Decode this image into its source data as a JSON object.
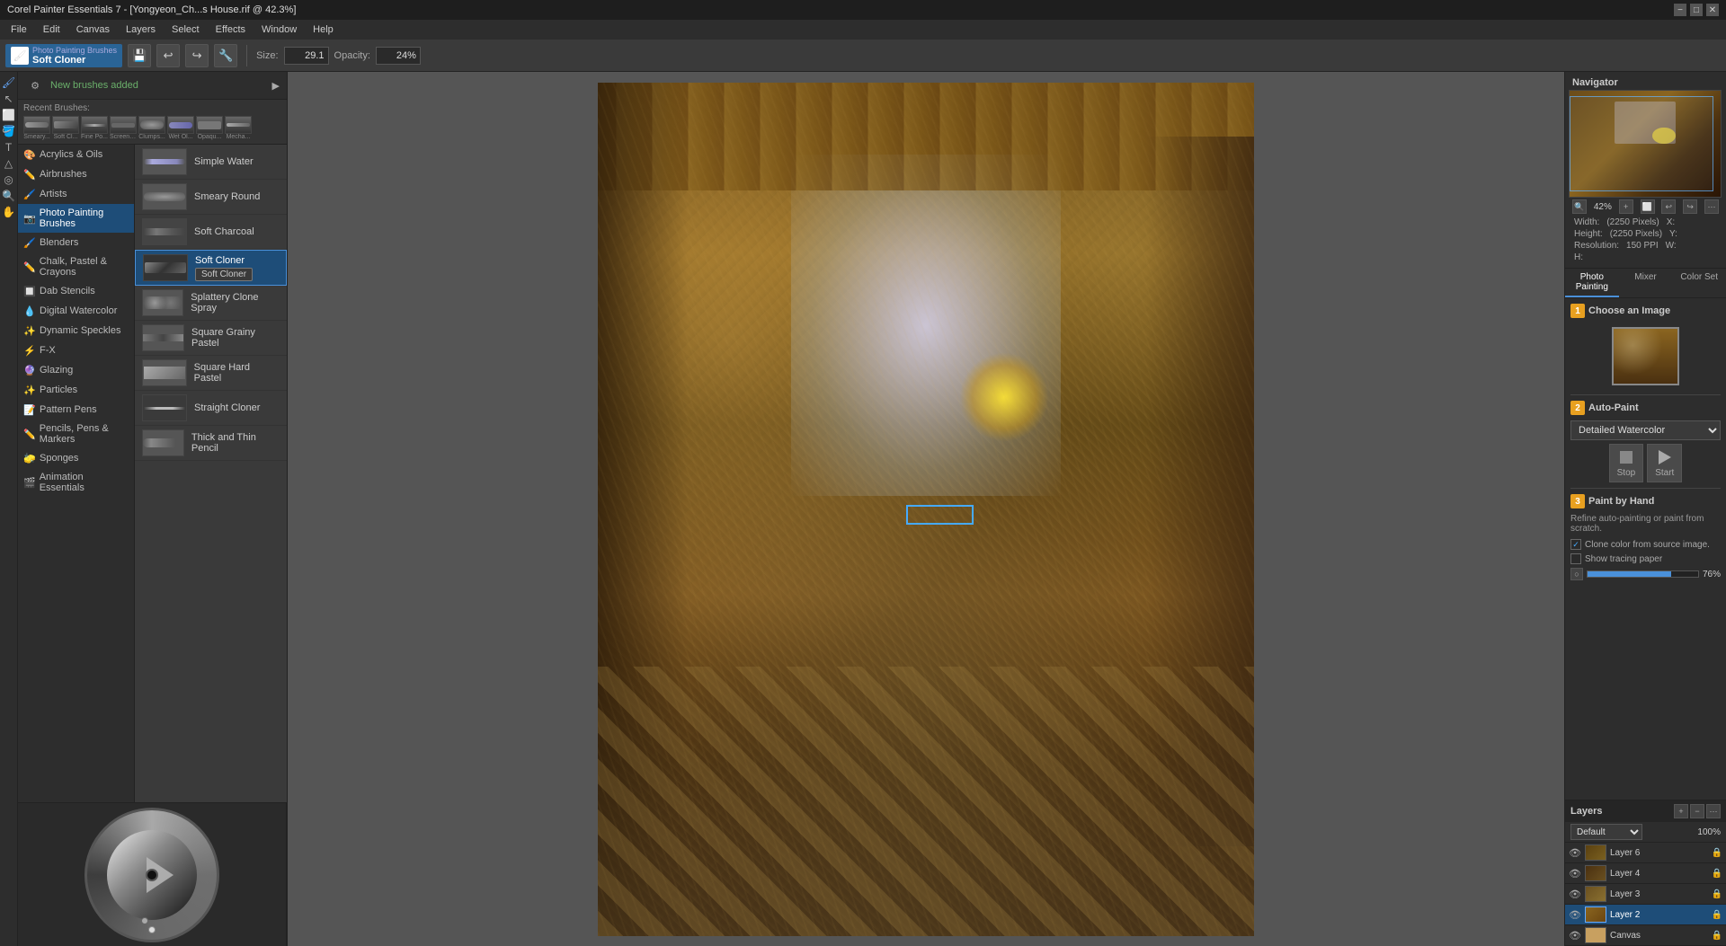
{
  "titleBar": {
    "title": "Corel Painter Essentials 7 - [Yongyeon_Ch...s House.rif @ 42.3%]",
    "winControls": [
      "−",
      "□",
      "✕"
    ]
  },
  "menuBar": {
    "items": [
      "File",
      "Edit",
      "Canvas",
      "Layers",
      "Select",
      "Effects",
      "Window",
      "Help"
    ]
  },
  "toolbar": {
    "brushCategory": "Photo Painting Brushes",
    "brushName": "Soft Cloner",
    "sizeLabel": "Size:",
    "sizeValue": "29.1",
    "opacityLabel": "Opacity:",
    "opacityValue": "24%"
  },
  "brushPanel": {
    "headerLink": "New brushes added",
    "recentLabel": "Recent Brushes:",
    "recentBrushes": [
      {
        "name": "Smeary...",
        "type": "smeary"
      },
      {
        "name": "Soft Cl...",
        "type": "softcl"
      },
      {
        "name": "Fine Po...",
        "type": "finepo"
      },
      {
        "name": "Screens...",
        "type": "screen"
      },
      {
        "name": "Clumps...",
        "type": "clumps"
      },
      {
        "name": "Wet Ol...",
        "type": "wetol"
      },
      {
        "name": "Opaqu...",
        "type": "opaqu"
      },
      {
        "name": "Mecha...",
        "type": "mecha"
      }
    ],
    "categories": [
      {
        "id": "acrylics",
        "icon": "🎨",
        "label": "Acrylics & Oils"
      },
      {
        "id": "airbrushes",
        "icon": "✏️",
        "label": "Airbrushes"
      },
      {
        "id": "artists",
        "icon": "🖌️",
        "label": "Artists"
      },
      {
        "id": "photo-painting",
        "icon": "📷",
        "label": "Photo Painting Brushes",
        "active": true
      },
      {
        "id": "blenders",
        "icon": "🖌️",
        "label": "Blenders"
      },
      {
        "id": "chalk-pastel",
        "icon": "✏️",
        "label": "Chalk, Pastel & Crayons"
      },
      {
        "id": "dab-stencils",
        "icon": "🔲",
        "label": "Dab Stencils"
      },
      {
        "id": "digital-watercolor",
        "icon": "💧",
        "label": "Digital Watercolor"
      },
      {
        "id": "dynamic-speckles",
        "icon": "✨",
        "label": "Dynamic Speckles"
      },
      {
        "id": "fx",
        "icon": "⚡",
        "label": "F-X"
      },
      {
        "id": "glazing",
        "icon": "🔮",
        "label": "Glazing"
      },
      {
        "id": "particles",
        "icon": "✨",
        "label": "Particles"
      },
      {
        "id": "pattern-pens",
        "icon": "📝",
        "label": "Pattern Pens"
      },
      {
        "id": "pencils",
        "icon": "✏️",
        "label": "Pencils, Pens & Markers"
      },
      {
        "id": "sponges",
        "icon": "🧽",
        "label": "Sponges"
      },
      {
        "id": "animation",
        "icon": "🎬",
        "label": "Animation Essentials"
      }
    ],
    "brushes": [
      {
        "id": "simple-water",
        "name": "Simple Water",
        "type": "simple-water"
      },
      {
        "id": "smeary-round",
        "name": "Smeary Round",
        "type": "smeary-round"
      },
      {
        "id": "soft-charcoal",
        "name": "Soft Charcoal",
        "type": "soft-charcoal"
      },
      {
        "id": "soft-cloner",
        "name": "Soft Cloner",
        "type": "soft-cloner",
        "active": true,
        "hasTag": true
      },
      {
        "id": "splattery",
        "name": "Splattery Clone Spray",
        "type": "splattery"
      },
      {
        "id": "square-grainy",
        "name": "Square Grainy Pastel",
        "type": "square-grainy"
      },
      {
        "id": "square-hard",
        "name": "Square Hard Pastel",
        "type": "square-hard"
      },
      {
        "id": "straight-cloner",
        "name": "Straight Cloner",
        "type": "straight"
      },
      {
        "id": "thick-thin",
        "name": "Thick and Thin Pencil",
        "type": "thick-thin"
      }
    ]
  },
  "navigator": {
    "title": "Navigator",
    "zoomValue": "42%",
    "widthLabel": "Width:",
    "widthValue": "(2250 Pixels)",
    "heightLabel": "Height:",
    "heightValue": "(2250 Pixels)",
    "resolutionLabel": "Resolution:",
    "resolutionValue": "150 PPI",
    "xLabel": "X:",
    "yLabel": "Y:",
    "wLabel": "W:",
    "hLabel": "H:"
  },
  "photoPainting": {
    "tabs": [
      "Photo Painting",
      "Mixer",
      "Color Set"
    ],
    "activeTab": 0,
    "step1": {
      "number": "1",
      "title": "Choose an Image"
    },
    "step2": {
      "number": "2",
      "title": "Auto-Paint",
      "dropdown": "Detailed Watercolor",
      "stopLabel": "Stop",
      "startLabel": "Start"
    },
    "step3": {
      "number": "3",
      "title": "Paint by Hand",
      "description": "Refine auto-painting or paint from scratch.",
      "cloneLabel": "Clone color from source image.",
      "tracingLabel": "Show tracing paper",
      "opacityValue": "76%"
    }
  },
  "layers": {
    "title": "Layers",
    "blendMode": "Default",
    "opacity": "100%",
    "items": [
      {
        "name": "Layer 6",
        "visible": true,
        "active": false,
        "type": "normal"
      },
      {
        "name": "Layer 4",
        "visible": true,
        "active": false,
        "type": "normal"
      },
      {
        "name": "Layer 3",
        "visible": true,
        "active": false,
        "type": "normal"
      },
      {
        "name": "Layer 2",
        "visible": true,
        "active": true,
        "type": "normal"
      },
      {
        "name": "Canvas",
        "visible": true,
        "active": false,
        "type": "canvas"
      }
    ]
  }
}
